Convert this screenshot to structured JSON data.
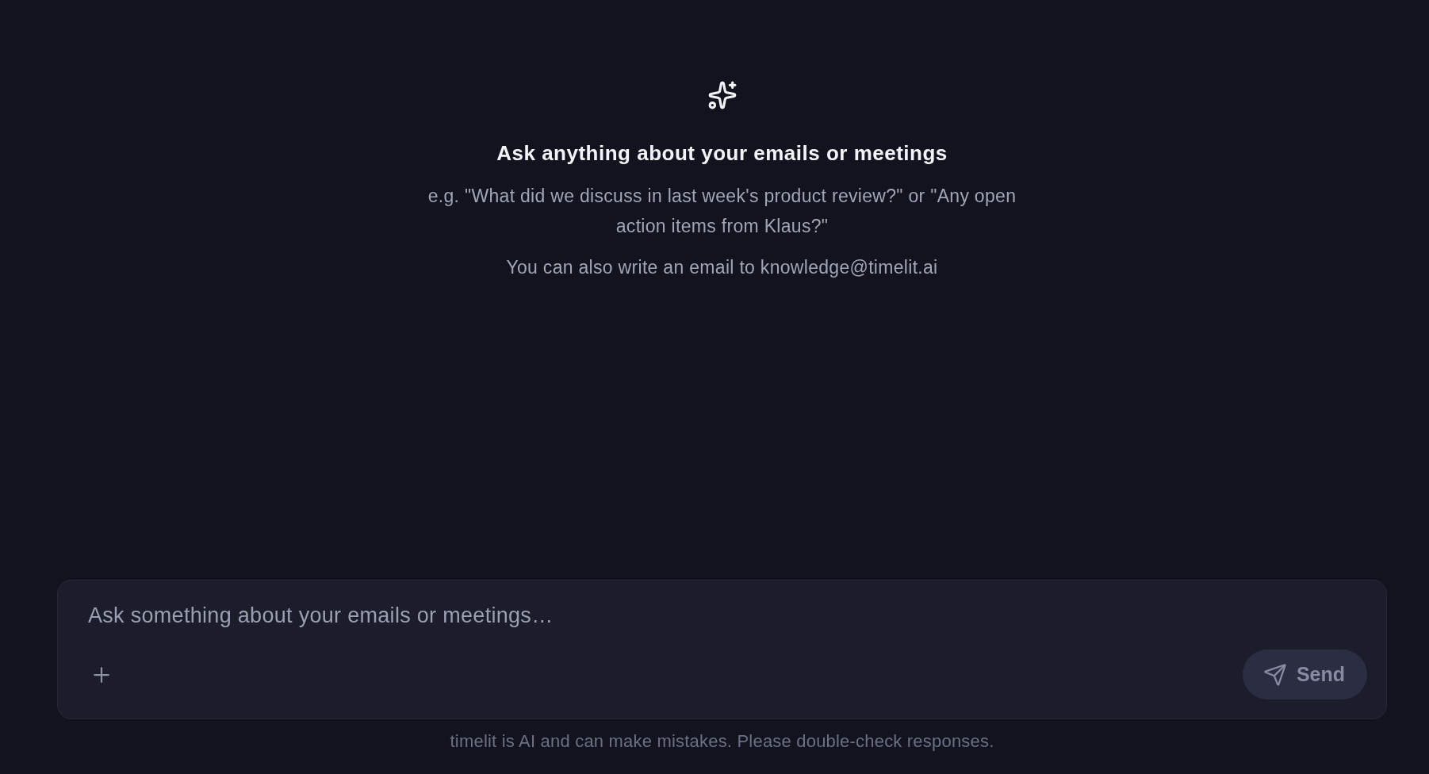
{
  "hero": {
    "title": "Ask anything about your emails or meetings",
    "examples": "e.g. \"What did we discuss in last week's product review?\" or \"Any open action items from Klaus?\"",
    "email_hint": "You can also write an email to knowledge@timelit.ai"
  },
  "composer": {
    "placeholder": "Ask something about your emails or meetings…",
    "send_button": {
      "label": "Send",
      "disabled": true
    }
  },
  "disclaimer": "timelit is AI and can make mistakes. Please double-check responses."
}
